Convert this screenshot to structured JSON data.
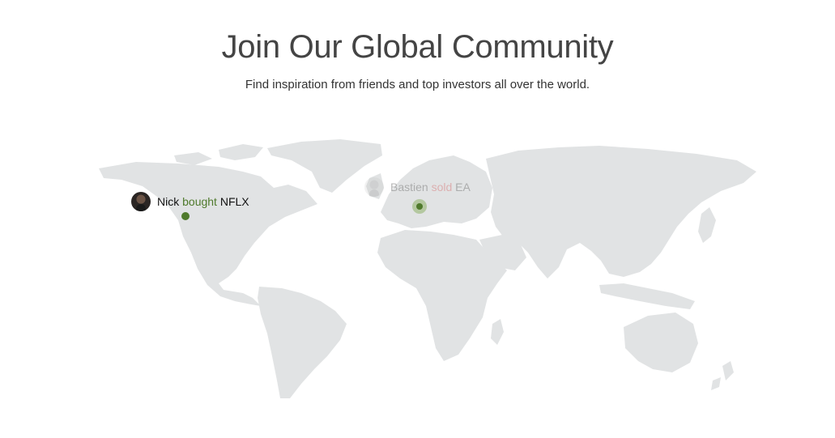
{
  "header": {
    "title": "Join Our Global Community",
    "subtitle": "Find inspiration from friends and top investors all over the world."
  },
  "activities": [
    {
      "name": "Nick",
      "verb": "bought",
      "ticker": "NFLX",
      "verb_type": "buy"
    },
    {
      "name": "Bastien",
      "verb": "sold",
      "ticker": "EA",
      "verb_type": "sell"
    }
  ],
  "colors": {
    "land": "#e1e3e4",
    "buy": "#4f7a2c",
    "sell": "#d98c8c",
    "marker": "#4f7a2c"
  }
}
